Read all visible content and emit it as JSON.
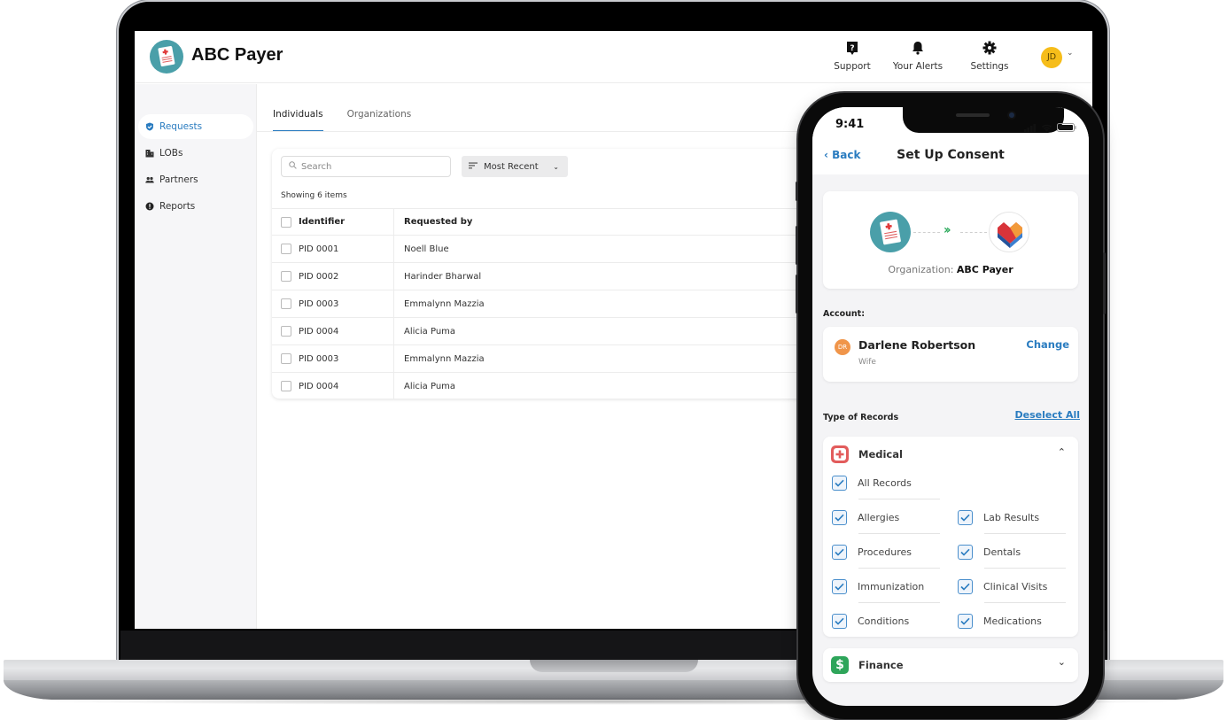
{
  "colors": {
    "accent": "#2a7cc0",
    "logo_teal": "#4a9fa9",
    "avatar_yellow": "#f6bd1a",
    "account_avatar_orange": "#f0954a",
    "medical_red": "#e25c5c",
    "finance_green": "#2ea55a",
    "consent_arrow_green": "#29a85a"
  },
  "desktop": {
    "app": {
      "title": "ABC Payer",
      "logo_icon": "medical-document-icon"
    },
    "header_actions": [
      {
        "label": "Support",
        "icon": "help-icon"
      },
      {
        "label": "Your Alerts",
        "icon": "bell-icon"
      },
      {
        "label": "Settings",
        "icon": "gear-icon"
      }
    ],
    "user": {
      "initials": "JD",
      "menu_icon": "chevron-down-icon"
    },
    "sidebar": {
      "items": [
        {
          "label": "Requests",
          "icon": "shield-check-icon",
          "active": true
        },
        {
          "label": "LOBs",
          "icon": "building-icon",
          "active": false
        },
        {
          "label": "Partners",
          "icon": "people-icon",
          "active": false
        },
        {
          "label": "Reports",
          "icon": "alert-circle-icon",
          "active": false
        }
      ]
    },
    "tabs": [
      {
        "label": "Individuals",
        "active": true
      },
      {
        "label": "Organizations",
        "active": false
      }
    ],
    "search": {
      "placeholder": "Search",
      "value": ""
    },
    "sort": {
      "selected": "Most Recent"
    },
    "showing_text": "Showing 6 items",
    "table": {
      "columns": [
        "Identifier",
        "Requested by"
      ],
      "rows": [
        {
          "identifier": "PID 0001",
          "requested_by": "Noell Blue"
        },
        {
          "identifier": "PID 0002",
          "requested_by": "Harinder Bharwal"
        },
        {
          "identifier": "PID 0003",
          "requested_by": "Emmalynn Mazzia"
        },
        {
          "identifier": "PID 0004",
          "requested_by": "Alicia Puma"
        },
        {
          "identifier": "PID 0003",
          "requested_by": "Emmalynn Mazzia"
        },
        {
          "identifier": "PID 0004",
          "requested_by": "Alicia Puma"
        }
      ]
    }
  },
  "phone": {
    "status_time": "9:41",
    "back_label": "Back",
    "title": "Set Up Consent",
    "organization": {
      "label": "Organization:",
      "name": "ABC Payer"
    },
    "account": {
      "section_label": "Account:",
      "initials": "DR",
      "name": "Darlene Robertson",
      "relation": "Wife",
      "change_label": "Change"
    },
    "records": {
      "section_label": "Type of Records",
      "deselect_label": "Deselect All",
      "categories": [
        {
          "title": "Medical",
          "icon": "medical-cross-icon",
          "expanded": true,
          "all_label": "All Records",
          "all_checked": true,
          "items": [
            {
              "label": "Allergies",
              "checked": true
            },
            {
              "label": "Lab Results",
              "checked": true
            },
            {
              "label": "Procedures",
              "checked": true
            },
            {
              "label": "Dentals",
              "checked": true
            },
            {
              "label": "Immunization",
              "checked": true
            },
            {
              "label": "Clinical Visits",
              "checked": true
            },
            {
              "label": "Conditions",
              "checked": true
            },
            {
              "label": "Medications",
              "checked": true
            }
          ]
        },
        {
          "title": "Finance",
          "icon": "dollar-icon",
          "expanded": false
        }
      ]
    }
  }
}
